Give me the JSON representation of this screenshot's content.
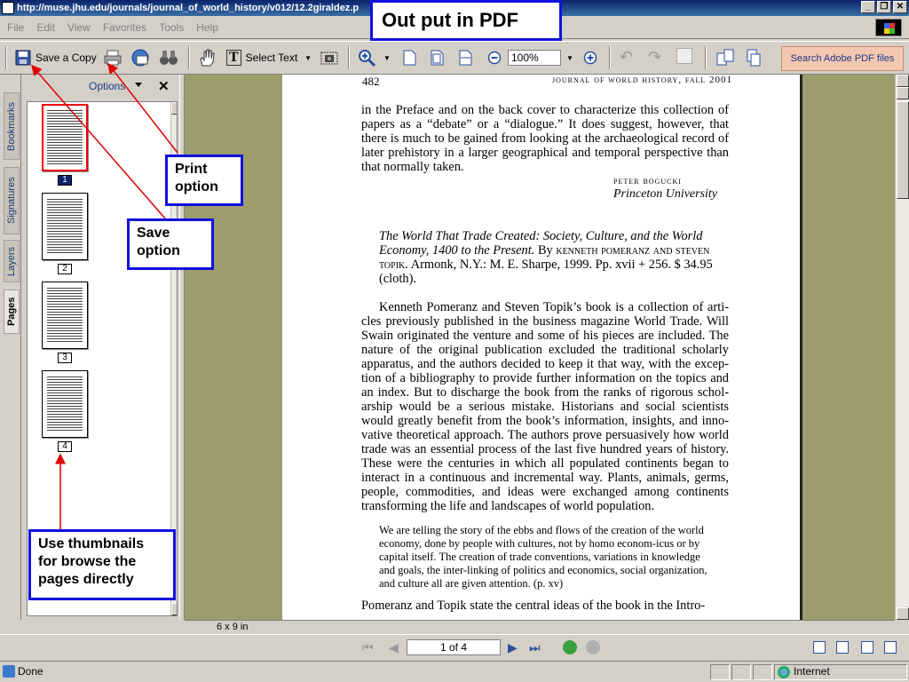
{
  "window": {
    "title": "http://muse.jhu.edu/journals/journal_of_world_history/v012/12.2giraldez.p"
  },
  "menu": [
    "File",
    "Edit",
    "View",
    "Favorites",
    "Tools",
    "Help"
  ],
  "toolbar": {
    "save_copy": "Save a Copy",
    "select_text": "Select Text",
    "zoom": "100%",
    "search": "Search Adobe PDF files"
  },
  "panel": {
    "tabs": [
      "Bookmarks",
      "Signatures",
      "Layers",
      "Pages"
    ],
    "options": "Options",
    "thumbnails": [
      "1",
      "2",
      "3",
      "4"
    ],
    "page_size": "6 x 9 in"
  },
  "page": {
    "number": "482",
    "running_head": "journal of world history, fall 2001",
    "para1": "in the Preface and on the back cover to characterize this collection of papers as a “debate” or a “dialogue.” It does suggest, however, that there is much to be gained from looking at the archaeological record of later prehistory in a larger geographical and temporal perspective than that normally taken.",
    "author": "peter bogucki",
    "affiliation": "Princeton University",
    "review_title": "The World That Trade Created: Society, Culture, and the World Economy, 1400 to the Present.",
    "review_by": "By",
    "review_authors": "kenneth pomeranz and steven topik.",
    "review_pub": "Armonk, N.Y.: M. E. Sharpe, 1999. Pp. xvii + 256. $ 34.95 (cloth).",
    "para2": "Kenneth Pomeranz and Steven Topik’s book is a collection of arti-cles previously published in the business magazine World Trade. Will Swain originated the venture and some of his pieces are included. The nature of the original publication excluded the traditional scholarly apparatus, and the authors decided to keep it that way, with the excep-tion of a bibliography to provide further information on the topics and an index. But to discharge the book from the ranks of rigorous schol-arship would be a serious mistake. Historians and social scientists would greatly benefit from the book’s information, insights, and inno-vative theoretical approach. The authors prove persuasively how world trade was an essential process of the last five hundred years of history. These were the centuries in which all populated continents began to interact in a continuous and incremental way. Plants, animals, germs, people, commodities, and ideas were exchanged among continents transforming the life and landscapes of world population.",
    "quote": "We are telling the story of the ebbs and flows of the creation of the world economy, done by people with cultures, not by homo econom-icus or by capital itself. The creation of trade conventions, variations in knowledge and goals, the inter-linking of politics and economics, social organization, and culture all are given attention. (p. xv)",
    "para3": "Pomeranz and Topik state the central ideas of the book in the Intro-"
  },
  "navigation": {
    "page_box": "1 of 4"
  },
  "status": {
    "left": "Done",
    "zone": "Internet"
  },
  "annotations": {
    "pdf_title": "Out put in PDF",
    "print": "Print option",
    "save": "Save option",
    "thumbs": "Use thumbnails for browse the pages directly"
  },
  "colors": {
    "callout_border": "#1010e0",
    "arrow": "#e00000",
    "doc_bg": "#9c9c6c"
  }
}
